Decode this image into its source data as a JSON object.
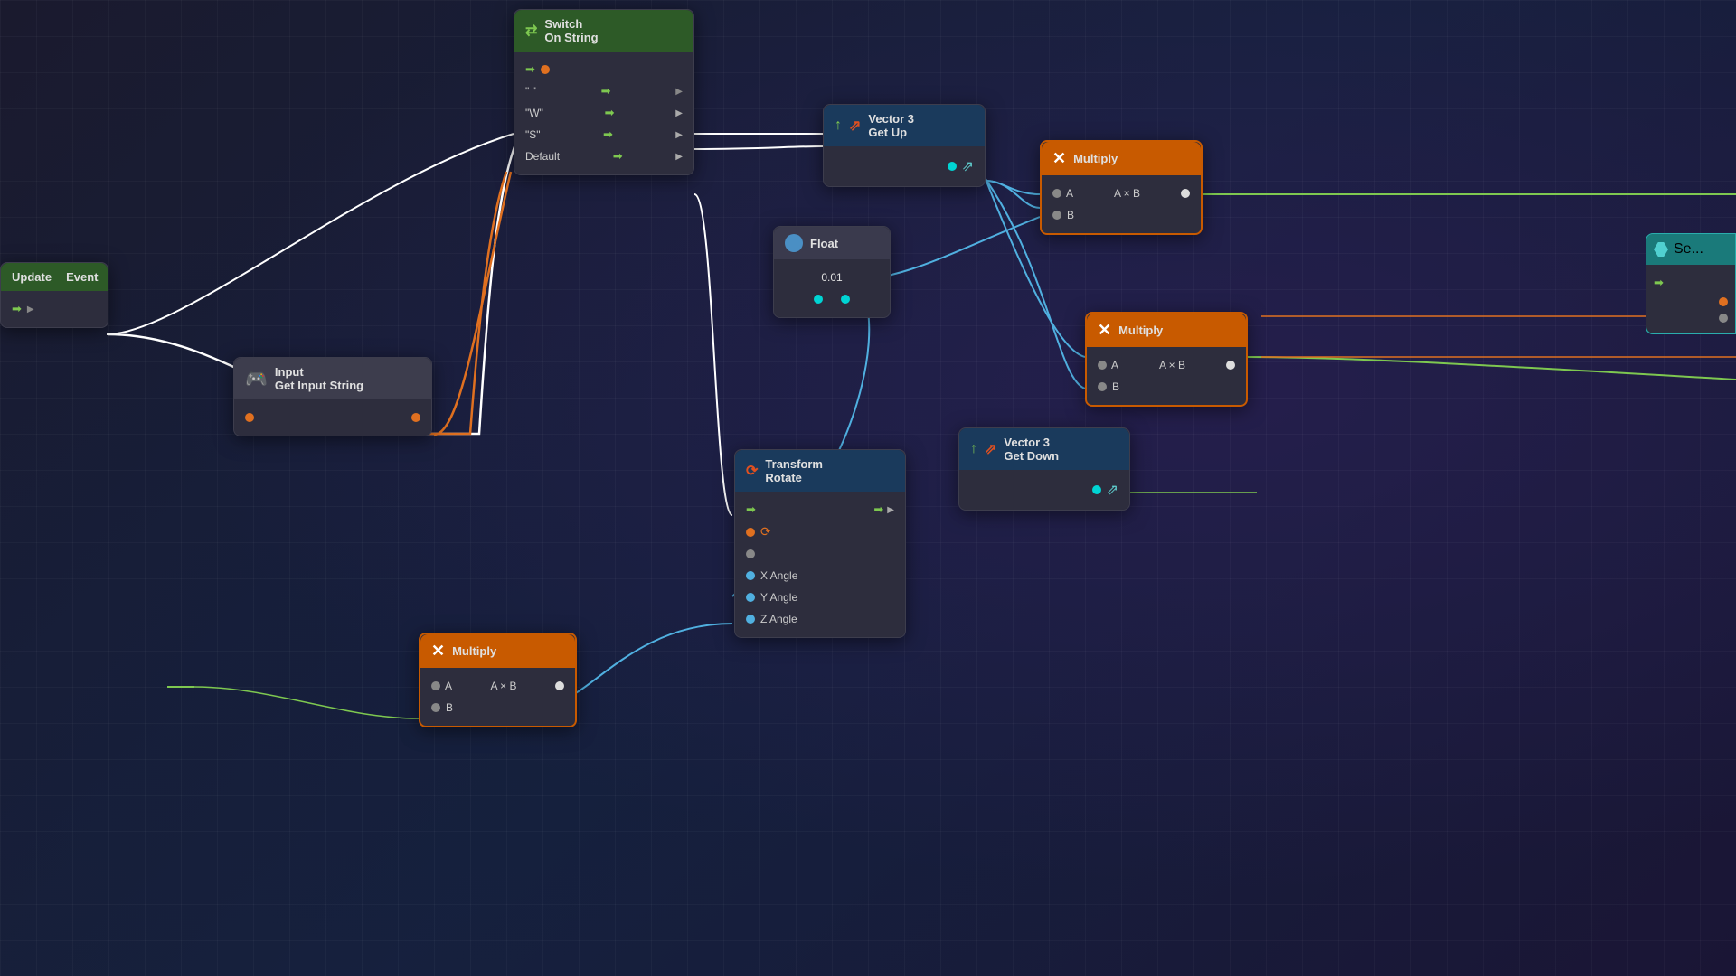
{
  "nodes": {
    "update_event": {
      "title_line1": "Update",
      "title_line2": "Event"
    },
    "input_string": {
      "title_line1": "Input",
      "title_line2": "Get Input String"
    },
    "switch_on_string": {
      "title_line1": "Switch",
      "title_line2": "On String",
      "rows": [
        "\" \"",
        "\"W\"",
        "\"S\"",
        "Default"
      ]
    },
    "vec3_get_up": {
      "title_line1": "Vector 3",
      "title_line2": "Get Up"
    },
    "multiply_top": {
      "title": "Multiply",
      "rows": [
        "A",
        "A × B",
        "B"
      ]
    },
    "float_node": {
      "title": "Float",
      "value": "0.01"
    },
    "multiply_mid": {
      "title": "Multiply",
      "rows": [
        "A",
        "A × B",
        "B"
      ]
    },
    "transform_rotate": {
      "title_line1": "Transform",
      "title_line2": "Rotate",
      "rows": [
        "X Angle",
        "Y Angle",
        "Z Angle"
      ]
    },
    "vec3_get_down": {
      "title_line1": "Vector 3",
      "title_line2": "Get Down"
    },
    "multiply_bot": {
      "title": "Multiply",
      "rows": [
        "A",
        "A × B",
        "B"
      ]
    },
    "se_node": {
      "title": "Se..."
    }
  },
  "colors": {
    "green_header": "#2d5a27",
    "blue_header": "#1a3a5c",
    "orange_border": "#c85a00",
    "teal_header": "#1a7a7a",
    "node_body": "#2d2d3d"
  }
}
